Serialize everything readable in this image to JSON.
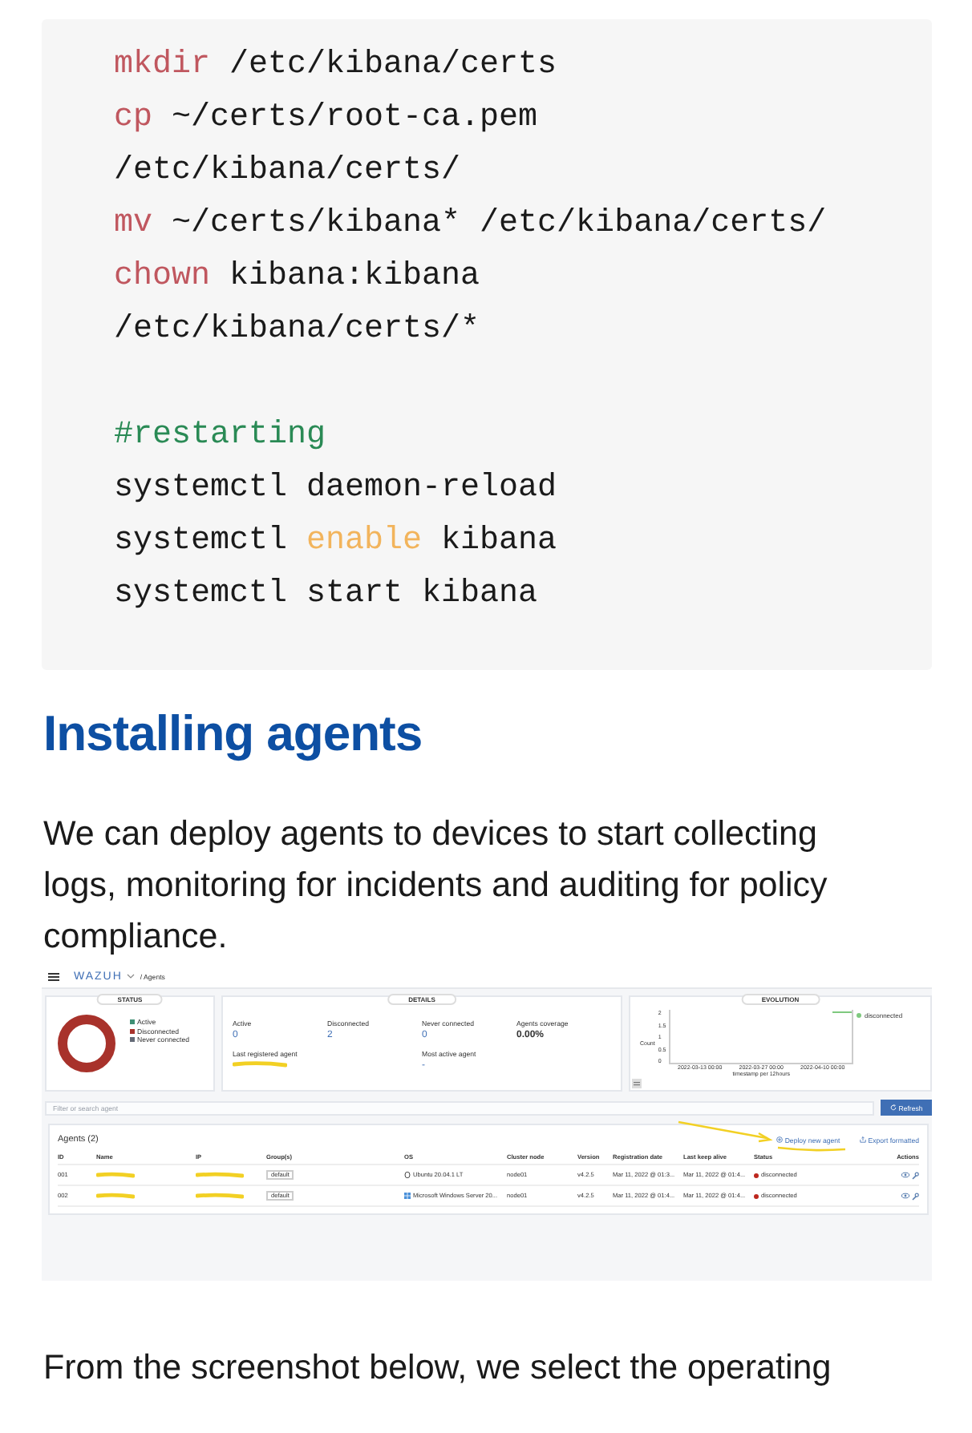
{
  "code_block": {
    "lines": [
      [
        {
          "text": "mkdir",
          "kind": "command"
        },
        {
          "text": " /etc/kibana/certs",
          "kind": "plain"
        }
      ],
      [
        {
          "text": "cp",
          "kind": "command"
        },
        {
          "text": " ~/certs/root-ca.pem",
          "kind": "plain"
        }
      ],
      [
        {
          "text": "/etc/kibana/certs/",
          "kind": "plain"
        }
      ],
      [
        {
          "text": "mv",
          "kind": "command"
        },
        {
          "text": " ~/certs/kibana* /etc/kibana/certs/",
          "kind": "plain"
        }
      ],
      [
        {
          "text": "chown",
          "kind": "command"
        },
        {
          "text": " kibana:kibana",
          "kind": "plain"
        }
      ],
      [
        {
          "text": "/etc/kibana/certs/*",
          "kind": "plain"
        }
      ],
      {
        "kind": "blank"
      },
      [
        {
          "text": "#restarting",
          "kind": "comment"
        }
      ],
      [
        {
          "text": "systemctl daemon-reload",
          "kind": "plain"
        }
      ],
      [
        {
          "text": "systemctl ",
          "kind": "plain"
        },
        {
          "text": "enable",
          "kind": "keyword"
        },
        {
          "text": " kibana",
          "kind": "plain"
        }
      ],
      [
        {
          "text": "systemctl start kibana",
          "kind": "plain"
        }
      ]
    ]
  },
  "heading": "Installing agents",
  "paragraph": "We can deploy agents to devices to start collecting logs, monitoring for incidents and auditing for policy compliance.",
  "embedded_screenshot": {
    "topbar": {
      "logo": "WAZUH",
      "breadcrumb": "/ Agents"
    },
    "status_panel": {
      "title": "STATUS",
      "legend": [
        {
          "label": "Active",
          "color": "#3f8f74"
        },
        {
          "label": "Disconnected",
          "color": "#a8322b"
        },
        {
          "label": "Never connected",
          "color": "#646a77"
        }
      ]
    },
    "details_panel": {
      "title": "DETAILS",
      "stats": [
        {
          "label": "Active",
          "value": "0",
          "kind": "link"
        },
        {
          "label": "Disconnected",
          "value": "2",
          "kind": "link"
        },
        {
          "label": "Never connected",
          "value": "0",
          "kind": "link"
        },
        {
          "label": "Agents coverage",
          "value": "0.00%",
          "kind": "plain"
        }
      ],
      "last_registered_label": "Last registered agent",
      "most_active_label": "Most active agent",
      "most_active_value": "-"
    },
    "evolution_panel": {
      "title": "EVOLUTION",
      "y_label": "Count",
      "y_ticks": [
        "2",
        "1.5",
        "1",
        "0.5",
        "0"
      ],
      "x_ticks": [
        "2022-03-13 00:00",
        "2022-03-27 00:00",
        "2022-04-10 00:00"
      ],
      "x_label": "timestamp per 12hours",
      "legend": "disconnected"
    },
    "search": {
      "placeholder": "Filter or search agent"
    },
    "refresh_button": "Refresh",
    "agents": {
      "title": "Agents (2)",
      "deploy_button": "Deploy new agent",
      "export_button": "Export formatted",
      "columns": [
        "ID",
        "Name",
        "IP",
        "Group(s)",
        "OS",
        "Cluster node",
        "Version",
        "Registration date",
        "Last keep alive",
        "Status",
        "Actions"
      ],
      "rows": [
        {
          "id": "001",
          "group": "default",
          "os": "Ubuntu 20.04.1 LT",
          "kind": "linux",
          "cluster": "node01",
          "version": "v4.2.5",
          "registered": "Mar 11, 2022 @ 01:3...",
          "keep_alive": "Mar 11, 2022 @ 01:4...",
          "status": "disconnected",
          "color": "#bd271e"
        },
        {
          "id": "002",
          "group": "default",
          "os": "Microsoft Windows Server 20...",
          "kind": "windows",
          "cluster": "node01",
          "version": "v4.2.5",
          "registered": "Mar 11, 2022 @ 01:4...",
          "keep_alive": "Mar 11, 2022 @ 01:4...",
          "status": "disconnected",
          "color": "#bd271e"
        }
      ]
    }
  },
  "closing_paragraph": "From the screenshot below, we select the operating"
}
